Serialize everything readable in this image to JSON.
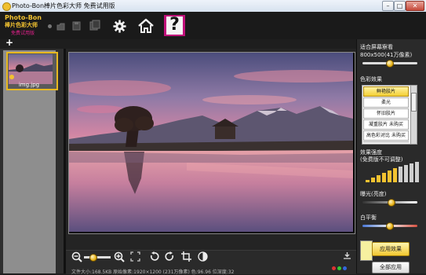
{
  "window": {
    "title": "Photo-Bon棒片色彩大师 免费试用版",
    "minimize": "–",
    "maximize": "□",
    "close": "✕"
  },
  "logo": {
    "line1": "Photo-Bon",
    "line2": "棒片色彩大师",
    "line3": "免费试用版"
  },
  "toolbar": {
    "icons": [
      "dot-icon",
      "open-icon",
      "save-icon",
      "save-as-icon",
      "settings-gear-icon",
      "home-icon",
      "help-question-icon"
    ],
    "help_symbol": "?"
  },
  "thumbnails": {
    "add_symbol": "+",
    "items": [
      {
        "label": "img.jpg"
      }
    ]
  },
  "bottombar": {
    "file_info": "文件大小:168.5KB   原始像素:1920×1200 (231万像素)   色:96.96   位深度:32"
  },
  "right_panel": {
    "fit_label": "适合屏幕察看",
    "size_label": "800x500(41万像素)",
    "size_level": 0.5,
    "effects_label": "色彩效果",
    "effects": [
      {
        "label": "鲜艳胶片",
        "selected": true
      },
      {
        "label": "柔光",
        "selected": false
      },
      {
        "label": "怀旧胶片",
        "selected": false
      },
      {
        "label": "凝重胶片 未购买",
        "selected": false
      },
      {
        "label": "高色彩对比 未购买",
        "selected": false
      },
      {
        "label": "",
        "selected": false
      }
    ],
    "strength_label": "效果强度",
    "strength_note": "(免费版不可调整)",
    "strength_level": 0.5,
    "exposure_label": "曝光(亮度)",
    "exposure_level": 0.53,
    "wb_label": "白平衡",
    "wb_level": 0.5,
    "apply_button": "应用效果",
    "apply_all_button": "全部应用"
  },
  "colors": {
    "accent": "#f2c230",
    "brand_pink": "#e0208a",
    "panel_bg": "#2a2a2a"
  }
}
